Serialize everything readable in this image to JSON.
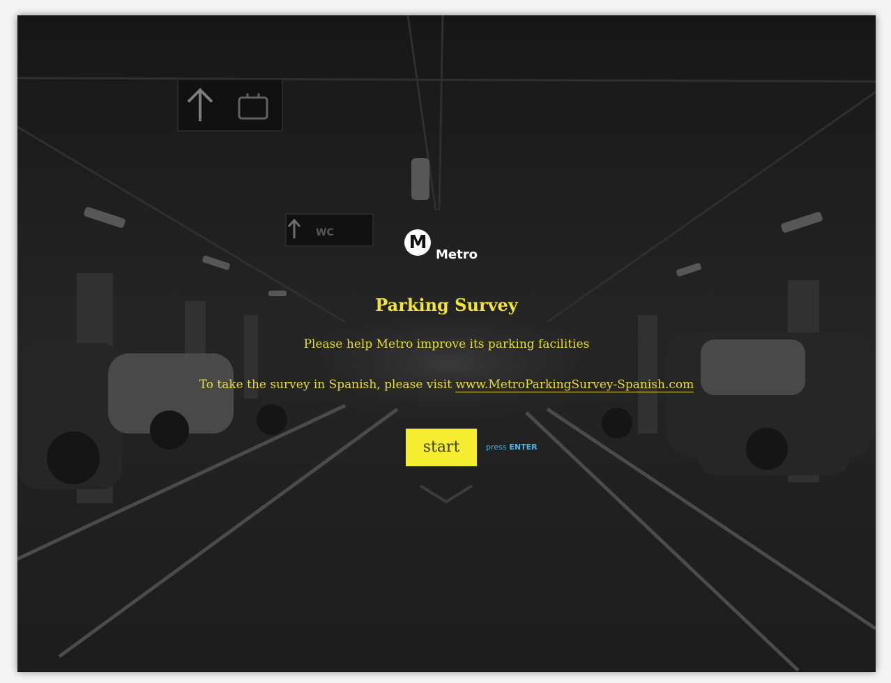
{
  "logo": {
    "mark": "M",
    "wordmark": "Metro"
  },
  "survey": {
    "title": "Parking Survey",
    "subtitle": "Please help Metro improve its parking facilities",
    "spanish_prefix": "To take the survey in Spanish, please visit ",
    "spanish_link": "www.MetroParkingSurvey-Spanish.com"
  },
  "start": {
    "label": "start",
    "hint_prefix": "press",
    "hint_key": "ENTER"
  },
  "colors": {
    "accent_yellow": "#f6ec30",
    "text_yellow": "#e9dc3c",
    "hint_blue": "#4fb4e8",
    "background": "#262626"
  },
  "icons": {
    "background": "parking-garage-photo",
    "sign_up": "up-arrow-icon",
    "sign_luggage": "luggage-icon",
    "sign_wc": "wc-icon"
  }
}
